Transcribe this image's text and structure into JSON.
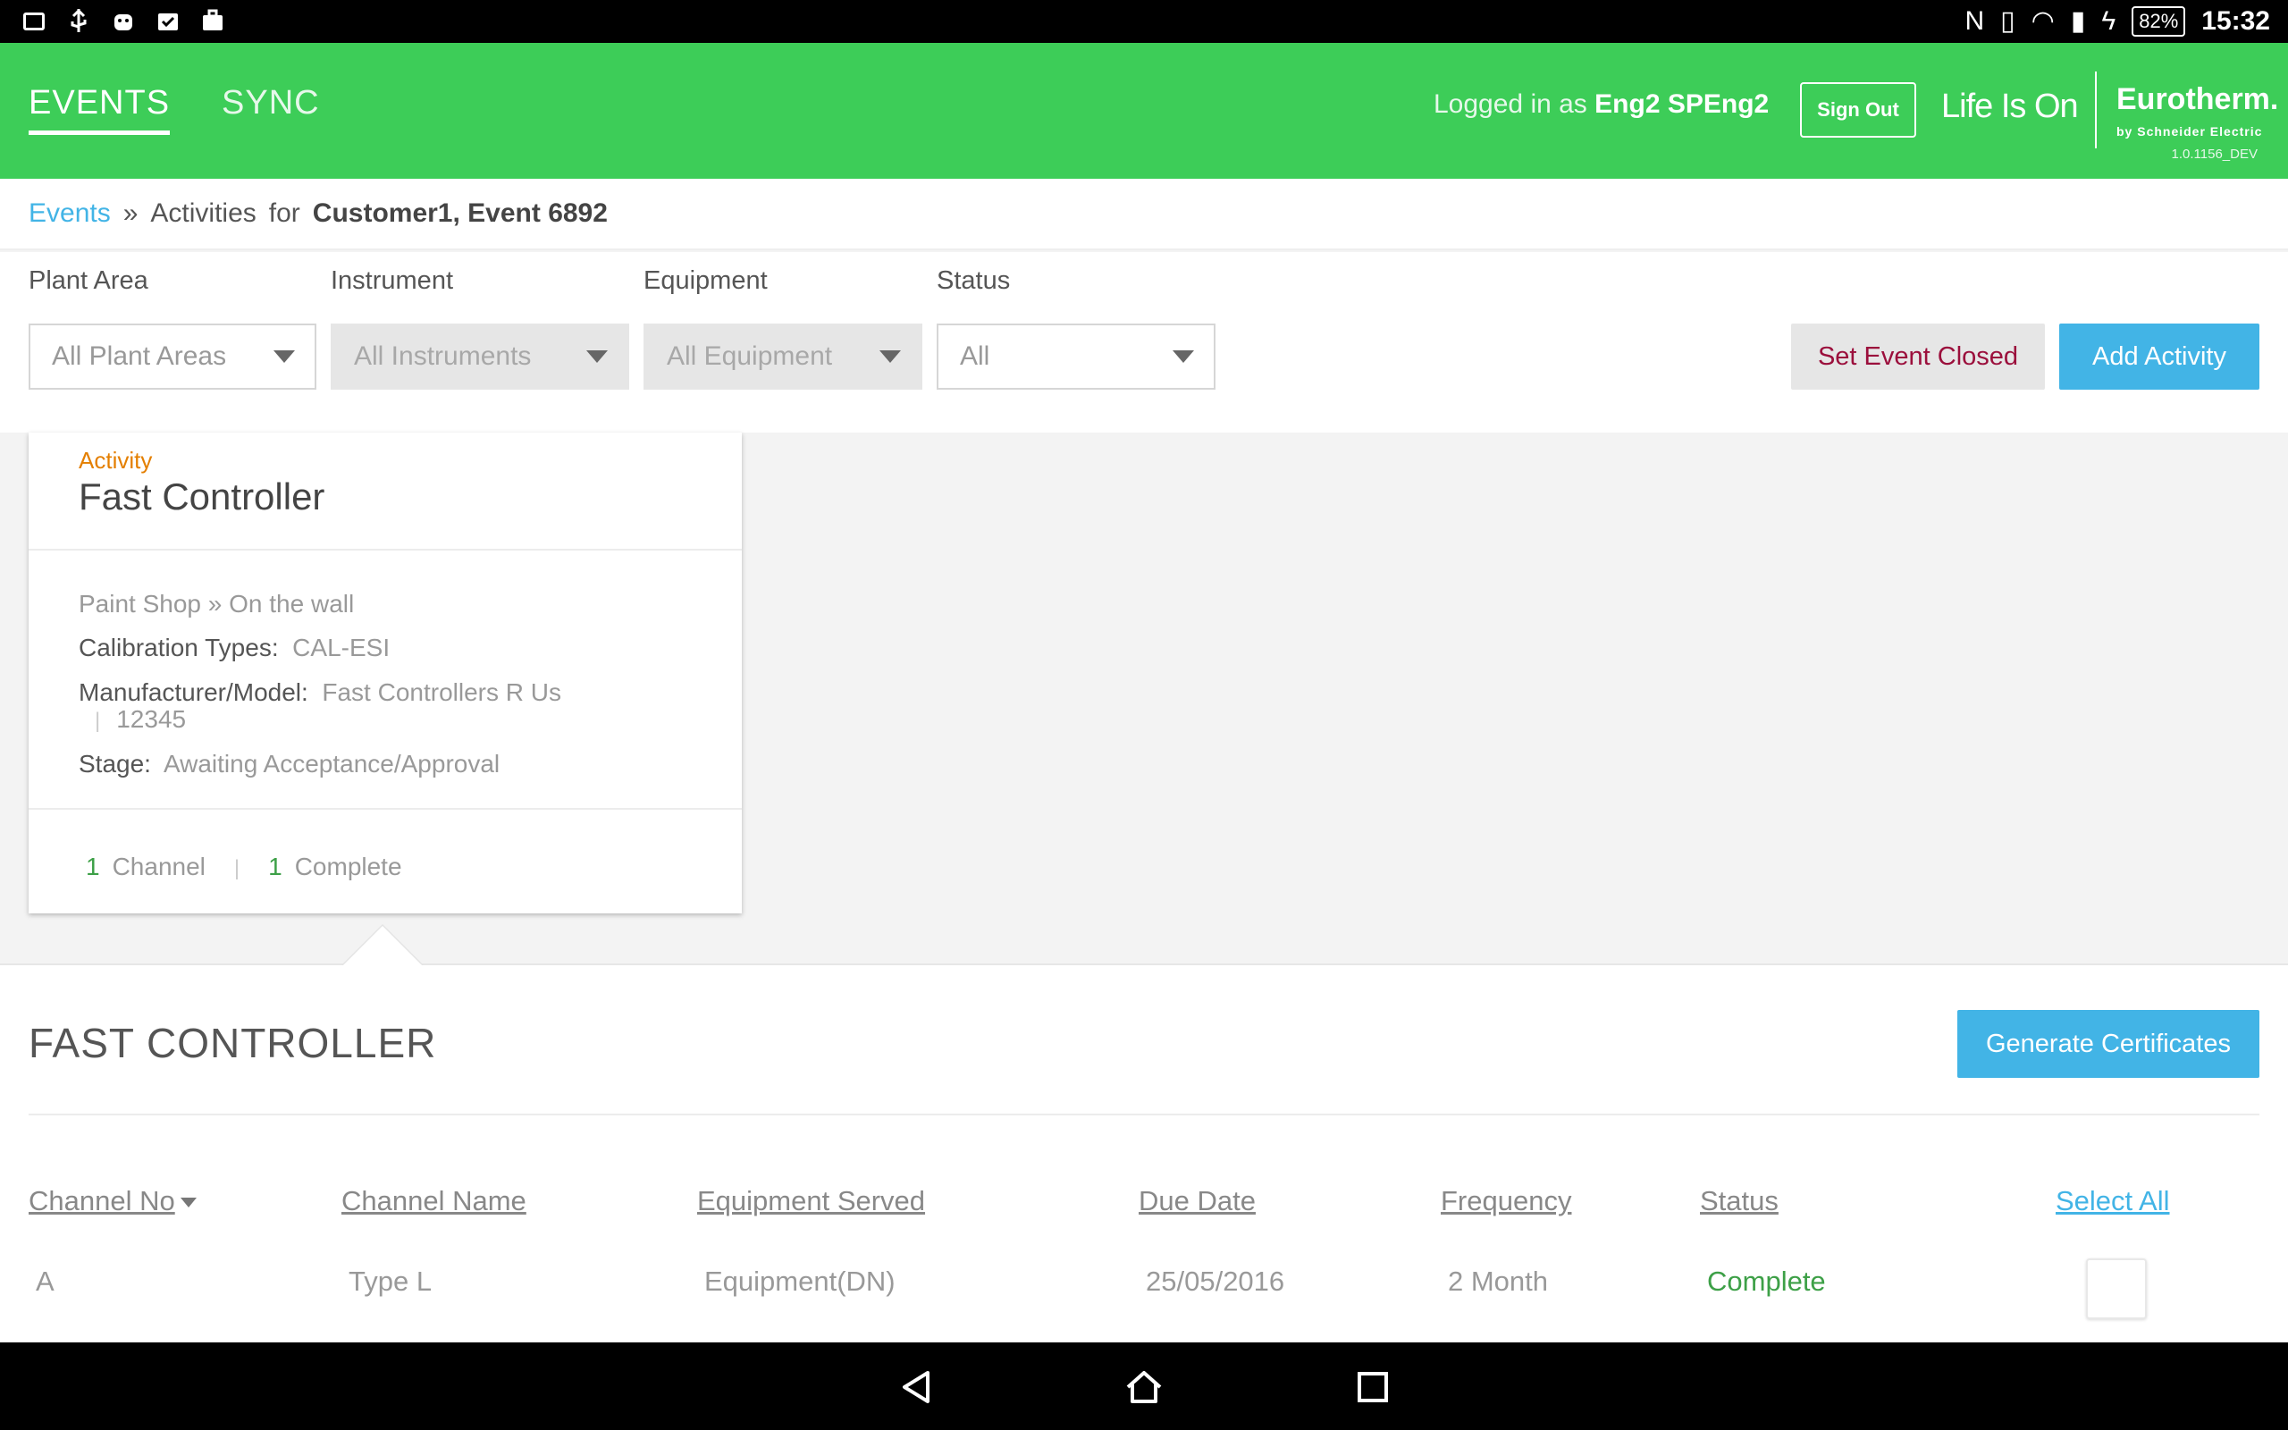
{
  "status_bar": {
    "battery": "82%",
    "time": "15:32"
  },
  "header": {
    "tabs": [
      "EVENTS",
      "SYNC"
    ],
    "logged_in_prefix": "Logged in as",
    "user": "Eng2 SPEng2",
    "sign_out": "Sign Out",
    "tagline": "Life Is On",
    "brand": "Eurotherm.",
    "brand_sub": "by Schneider Electric",
    "version": "1.0.1156_DEV"
  },
  "breadcrumb": {
    "root": "Events",
    "current": "Activities",
    "for_label": "for",
    "context": "Customer1, Event 6892"
  },
  "filters": {
    "plant_area": {
      "label": "Plant Area",
      "value": "All Plant Areas"
    },
    "instrument": {
      "label": "Instrument",
      "value": "All Instruments"
    },
    "equipment": {
      "label": "Equipment",
      "value": "All Equipment"
    },
    "status": {
      "label": "Status",
      "value": "All"
    },
    "set_event_closed": "Set Event Closed",
    "add_activity": "Add Activity"
  },
  "activity_card": {
    "kicker": "Activity",
    "title": "Fast Controller",
    "area": "Paint Shop",
    "location": "On the wall",
    "calibration_label": "Calibration Types:",
    "calibration_value": "CAL-ESI",
    "manufacturer_label": "Manufacturer/Model:",
    "manufacturer_value": "Fast Controllers R Us",
    "model_value": "12345",
    "stage_label": "Stage:",
    "stage_value": "Awaiting Acceptance/Approval",
    "channel_count": "1",
    "channel_label": "Channel",
    "complete_count": "1",
    "complete_label": "Complete"
  },
  "detail": {
    "title": "FAST CONTROLLER",
    "generate": "Generate Certificates",
    "columns": [
      "Channel No",
      "Channel Name",
      "Equipment Served",
      "Due Date",
      "Frequency",
      "Status"
    ],
    "select_all": "Select All",
    "rows": [
      {
        "channel_no": "A",
        "channel_name": "Type L",
        "equipment": "Equipment(DN)",
        "due_date": "25/05/2016",
        "frequency": "2 Month",
        "status": "Complete"
      }
    ]
  },
  "colors": {
    "header_green": "#3dcd58",
    "accent_blue": "#42b4e6",
    "kicker_orange": "#e47f00",
    "complete_green": "#3da047",
    "close_red": "#9b0f3c"
  }
}
